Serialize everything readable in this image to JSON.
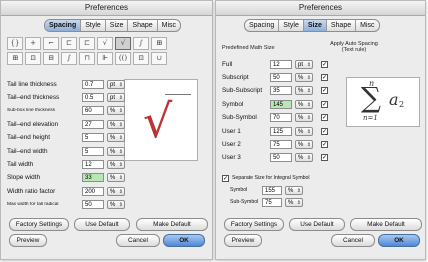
{
  "left": {
    "title": "Preferences",
    "tabs": [
      "Spacing",
      "Style",
      "Size",
      "Shape",
      "Misc"
    ],
    "active_tab": "Spacing",
    "icons": [
      "{}",
      "+",
      "⌐",
      "⊏",
      "⊏",
      "√",
      "√",
      "∫",
      "⊞",
      "⊞",
      "⊡",
      "⊟",
      "∫",
      "⊓",
      "⊩",
      "(()",
      "⊡",
      "∪"
    ],
    "rows": [
      {
        "label": "Tail line thickness",
        "value": "0.7",
        "unit": "pt",
        "small": false
      },
      {
        "label": "Tail–end thickness",
        "value": "0.5",
        "unit": "pt",
        "small": false
      },
      {
        "label": "Sub-box line thickness",
        "value": "60",
        "unit": "%",
        "small": true
      },
      {
        "label": "Tail–end elevation",
        "value": "27",
        "unit": "%",
        "small": false
      },
      {
        "label": "Tail–end height",
        "value": "5",
        "unit": "%",
        "small": false
      },
      {
        "label": "Tail–end width",
        "value": "5",
        "unit": "%",
        "small": false
      },
      {
        "label": "Tail width",
        "value": "12",
        "unit": "%",
        "small": false
      },
      {
        "label": "Slope width",
        "value": "33",
        "unit": "%",
        "small": false,
        "highlight": true
      },
      {
        "label": "Width ratio factor",
        "value": "200",
        "unit": "%",
        "small": false
      },
      {
        "label": "Max width for tall radical",
        "value": "50",
        "unit": "%",
        "small": true
      }
    ],
    "preview_glyph": "√",
    "buttons": {
      "factory": "Factory Settings",
      "use_default": "Use Default",
      "make_default": "Make Default",
      "preview": "Preview",
      "cancel": "Cancel",
      "ok": "OK"
    }
  },
  "right": {
    "title": "Preferences",
    "tabs": [
      "Spacing",
      "Style",
      "Size",
      "Shape",
      "Misc"
    ],
    "active_tab": "Size",
    "header_left": "Predefined Math Size",
    "header_right": "Apply Auto Spacing (Text rule)",
    "rows": [
      {
        "label": "Full",
        "value": "12",
        "unit": "pt",
        "checked": true
      },
      {
        "label": "Subscript",
        "value": "50",
        "unit": "%",
        "checked": true
      },
      {
        "label": "Sub-Subscript",
        "value": "35",
        "unit": "%",
        "checked": true
      },
      {
        "label": "Symbol",
        "value": "145",
        "unit": "%",
        "checked": true,
        "highlight": true
      },
      {
        "label": "Sub-Symbol",
        "value": "70",
        "unit": "%",
        "checked": true
      },
      {
        "label": "User 1",
        "value": "125",
        "unit": "%",
        "checked": true
      },
      {
        "label": "User 2",
        "value": "75",
        "unit": "%",
        "checked": true
      },
      {
        "label": "User 3",
        "value": "50",
        "unit": "%",
        "checked": true
      }
    ],
    "separate_label": "Separate Size for Integral Symbol",
    "separate_checked": true,
    "sub_rows": [
      {
        "label": "Symbol",
        "value": "155",
        "unit": "%"
      },
      {
        "label": "Sub-Symbol",
        "value": "75",
        "unit": "%"
      }
    ],
    "preview": {
      "sup": "n",
      "sigma": "∑",
      "base": "a",
      "base_sub": "2",
      "lower": "n=1"
    },
    "buttons": {
      "factory": "Factory Settings",
      "use_default": "Use Default",
      "make_default": "Make Default",
      "preview": "Preview",
      "cancel": "Cancel",
      "ok": "OK"
    }
  }
}
